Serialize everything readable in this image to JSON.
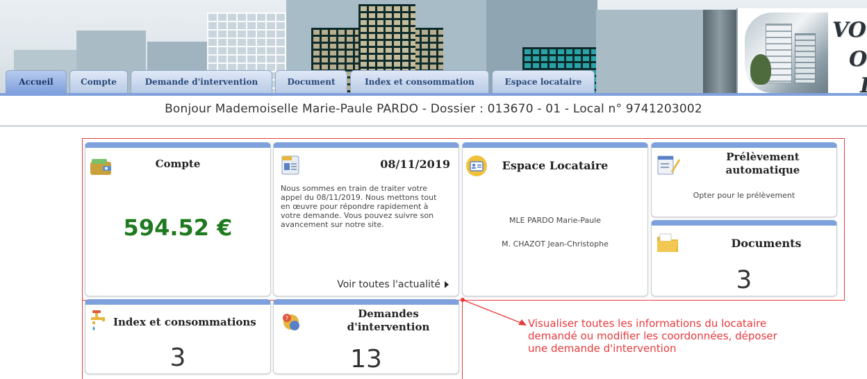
{
  "banner": {
    "logo_lines": [
      "VOT",
      "O",
      "I"
    ]
  },
  "tabs": [
    {
      "label": "Accueil",
      "active": true
    },
    {
      "label": "Compte",
      "active": false
    },
    {
      "label": "Demande d'intervention",
      "active": false
    },
    {
      "label": "Document",
      "active": false
    },
    {
      "label": "Index et consommation",
      "active": false
    },
    {
      "label": "Espace locataire",
      "active": false
    }
  ],
  "greeting": "Bonjour Mademoiselle Marie-Paule PARDO - Dossier : 013670 - 01 - Local n° 9741203002",
  "tiles": {
    "compte": {
      "title": "Compte",
      "amount": "594.52 €",
      "icon": "wallet-icon"
    },
    "news": {
      "date": "08/11/2019",
      "icon": "newspaper-icon",
      "text": "Nous sommes en train de traiter votre appel du 08/11/2019. Nous mettons tout en œuvre pour répondre rapidement à votre demande. Vous pouvez suivre son avancement sur notre site.",
      "link": "Voir toutes l'actualité"
    },
    "espace": {
      "title": "Espace Locataire",
      "icon": "id-card-icon",
      "tenant1": "MLE PARDO Marie-Paule",
      "tenant2": "M. CHAZOT Jean-Christophe"
    },
    "prelevement": {
      "title": "Prélèvement automatique",
      "icon": "notepad-icon",
      "link": "Opter pour le prélèvement"
    },
    "documents": {
      "title": "Documents",
      "count": "3",
      "icon": "folder-icon"
    },
    "index": {
      "title": "Index et consommations",
      "count": "3",
      "icon": "faucet-icon"
    },
    "demandes": {
      "title": "Demandes d'intervention",
      "count": "13",
      "icon": "support-icon"
    }
  },
  "annotation": {
    "text": "Visualiser toutes les informations du locataire demandé ou modifier les coordonnées, déposer une demande d'intervention",
    "color": "#e8393c"
  },
  "colors": {
    "tab_active": "#7fa0dc",
    "tile_header": "#7ea1dd",
    "amount": "#1f7a1f",
    "frame": "#e8393c"
  }
}
